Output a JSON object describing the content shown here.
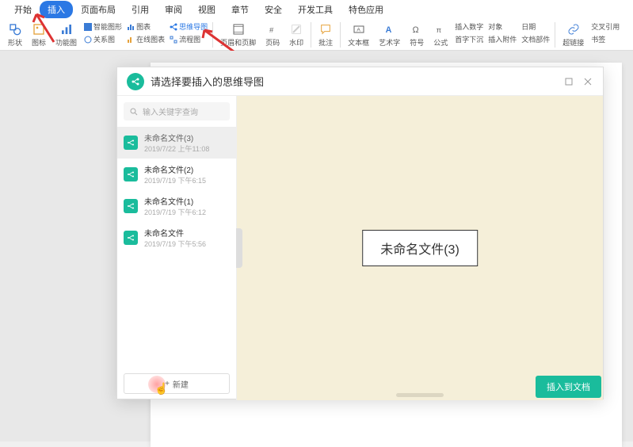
{
  "menubar": {
    "items": [
      "开始",
      "插入",
      "页面布局",
      "引用",
      "审阅",
      "视图",
      "章节",
      "安全",
      "开发工具",
      "特色应用"
    ],
    "active_index": 1
  },
  "ribbon": {
    "groups": [
      {
        "label": "形状",
        "type": "large"
      },
      {
        "label": "图标",
        "type": "large"
      },
      {
        "label": "功能图",
        "type": "large"
      },
      {
        "items": [
          "智能图形",
          "关系图"
        ],
        "type": "small"
      },
      {
        "items": [
          "图表",
          "在线图表"
        ],
        "type": "small"
      },
      {
        "items": [
          "思维导图",
          "流程图"
        ],
        "type": "small",
        "highlight": 0
      },
      {
        "label": "页眉和页脚",
        "type": "large"
      },
      {
        "label": "页码",
        "type": "large"
      },
      {
        "label": "水印",
        "type": "large"
      },
      {
        "label": "批注",
        "type": "large"
      },
      {
        "label": "文本框",
        "type": "large"
      },
      {
        "label": "艺术字",
        "type": "large"
      },
      {
        "label": "符号",
        "type": "large"
      },
      {
        "label": "公式",
        "type": "large"
      },
      {
        "items": [
          "插入数字",
          "首字下沉"
        ],
        "type": "small"
      },
      {
        "items": [
          "对象",
          "插入附件"
        ],
        "type": "small"
      },
      {
        "items": [
          "日期",
          "文档部件"
        ],
        "type": "small"
      },
      {
        "label": "超链接",
        "type": "large"
      },
      {
        "items": [
          "交叉引用",
          "书签"
        ],
        "type": "small"
      }
    ]
  },
  "dialog": {
    "title": "请选择要插入的思维导图",
    "search_placeholder": "输入关键字查询",
    "files": [
      {
        "name": "未命名文件(3)",
        "date": "2019/7/22 上午11:08"
      },
      {
        "name": "未命名文件(2)",
        "date": "2019/7/19 下午6:15"
      },
      {
        "name": "未命名文件(1)",
        "date": "2019/7/19 下午6:12"
      },
      {
        "name": "未命名文件",
        "date": "2019/7/19 下午5:56"
      }
    ],
    "selected_index": 0,
    "new_button": "新建",
    "preview_node": "未命名文件(3)",
    "insert_button": "插入到文档"
  }
}
